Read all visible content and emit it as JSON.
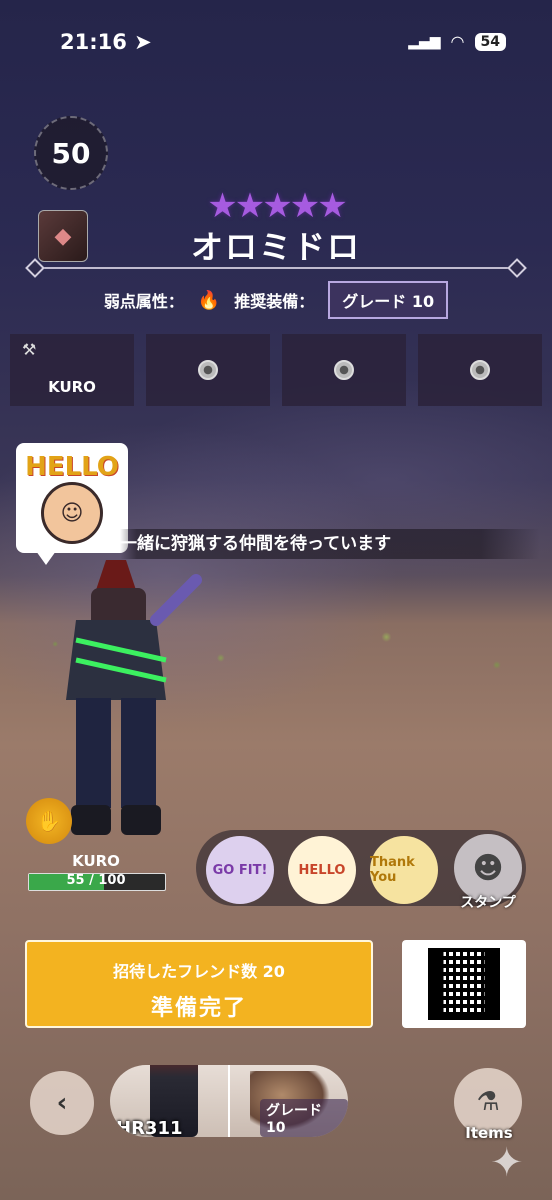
{
  "status_bar": {
    "time": "21:16",
    "battery": "54"
  },
  "quest": {
    "level": "50",
    "stars": "★★★★★",
    "monster_name": "オロミドロ",
    "weakness_label": "弱点属性：",
    "recommended_label": "推奨装備：",
    "grade": "グレード 10"
  },
  "party": {
    "slots": [
      {
        "name": "KURO",
        "filled": true
      },
      {
        "name": "",
        "filled": false
      },
      {
        "name": "",
        "filled": false
      },
      {
        "name": "",
        "filled": false
      }
    ]
  },
  "chat": {
    "message": "一緒に狩猟する仲間を待っています",
    "sticker_text": "HELLO"
  },
  "player": {
    "name": "KURO",
    "hp": "55 / 100",
    "hp_fraction": 0.55
  },
  "stamps": {
    "label": "スタンプ",
    "items": [
      "GO FIT!",
      "HELLO",
      "Thank You"
    ]
  },
  "ready_button": {
    "invited_label": "招待したフレンド数 20",
    "main_label": "準備完了"
  },
  "bottom_nav": {
    "hr_label": "HR311",
    "grade_label": "グレード 10",
    "items_label": "Items"
  },
  "colors": {
    "accent": "#f3b320",
    "star": "#a65be0",
    "hp": "#3aa84a"
  }
}
